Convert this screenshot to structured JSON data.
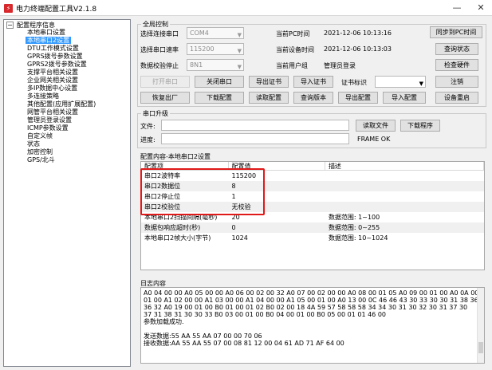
{
  "window": {
    "title": "电力终端配置工具V2.1.8",
    "minimize": "—",
    "close": "✕"
  },
  "tree": {
    "root": "配置程序信息",
    "toggle": "−",
    "items": [
      "本地串口设置",
      "本地串口2设置",
      "DTU工作模式设置",
      "GPRS拨号参数设置",
      "GPRS2拨号参数设置",
      "支撑平台相关设置",
      "企业网关相关设置",
      "多IP数据中心设置",
      "多连接策略",
      "其他配置(应用扩展配置)",
      "网管平台相关设置",
      "管理员登录设置",
      "ICMP参数设置",
      "自定义帧",
      "状态",
      "加密控制",
      "GPS/北斗"
    ],
    "selected_index": 1
  },
  "global": {
    "title": "全局控制",
    "port_label": "选择连接串口",
    "port_value": "COM4",
    "baud_label": "选择串口速率",
    "baud_value": "115200",
    "parity_label": "数据校验停止",
    "parity_value": "8N1",
    "pc_time_label": "当前PC时间",
    "pc_time_value": "2021-12-06 10:13:16",
    "dev_time_label": "当前设备时间",
    "dev_time_value": "2021-12-06 10:13:03",
    "user_label": "当前用户组",
    "user_value": "管理员登录",
    "btn_sync": "同步到PC时间",
    "btn_query_status": "查询状态",
    "btn_check_hw": "检查硬件",
    "btn_open_port": "打开串口",
    "btn_close_port": "关闭串口",
    "btn_export_cert": "导出证书",
    "btn_import_cert": "导入证书",
    "cert_label": "证书标识",
    "btn_logout": "注销",
    "btn_factory": "恢复出厂",
    "btn_download_cfg": "下载配置",
    "btn_read_cfg": "读取配置",
    "btn_query_ver": "查询版本",
    "btn_export_cfg": "导出配置",
    "btn_import_cfg": "导入配置",
    "btn_reboot": "设备重启"
  },
  "upgrade": {
    "title": "串口升级",
    "file_label": "文件:",
    "progress_label": "进度:",
    "btn_read_file": "读取文件",
    "btn_download": "下载程序",
    "status": "FRAME OK"
  },
  "config": {
    "title": "配置内容-本地串口2设置",
    "headers": [
      "配置项",
      "配置值",
      "描述"
    ],
    "rows": [
      [
        "串口2波特率",
        "115200",
        ""
      ],
      [
        "串口2数据位",
        "8",
        ""
      ],
      [
        "串口2停止位",
        "1",
        ""
      ],
      [
        "串口2校验位",
        "无校验",
        ""
      ],
      [
        "本地串口2扫描间隔(毫秒)",
        "20",
        "数据范围: 1~100"
      ],
      [
        "数据包响应超时(秒)",
        "0",
        "数据范围: 0~255"
      ],
      [
        "本地串口2帧大小(字节)",
        "1024",
        "数据范围: 10~1024"
      ]
    ]
  },
  "log": {
    "title": "日志内容",
    "lines": [
      "A0 04 00 00 A0 05 00 00 A0 06 00 02 00 32 A0 07 00 02 00 00 A0 08 00 01 05 A0 09 00 01 00 A0 0A 00",
      "01 00 A1 02 00 00 A1 03 00 00 A1 04 00 00 A1 05 00 01 00 A0 13 00 0C 46 46 43 30 33 30 30 31 38 36",
      "36 32 A0 19 00 01 00 B0 01 00 01 02 B0 02 00 18 4A 59 57 58 58 58 34 34 30 31 30 32 30 31 37 30",
      "37 31 38 31 30 30 33 B0 03 00 01 00 B0 04 00 01 00 B0 05 00 01 01 46 00",
      "参数加载成功.",
      "",
      "发送数据:55 AA 55 AA 07 00 00 70 06",
      "接收数据:AA 55 AA 55 07 00 08 81 12 00 04 61 AD 71 AF 64 00"
    ]
  }
}
